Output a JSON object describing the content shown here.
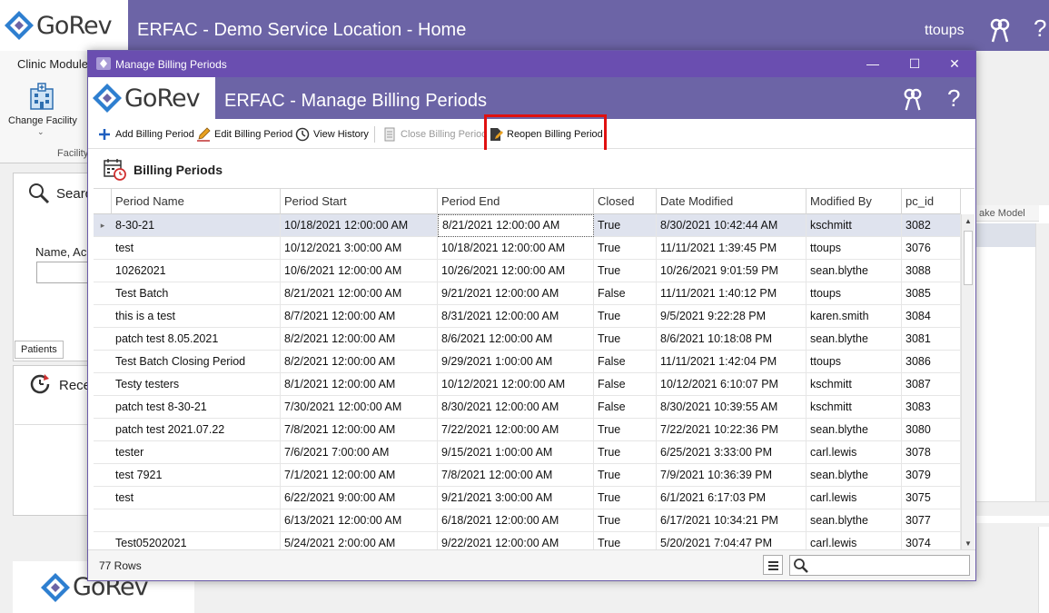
{
  "app": {
    "brand": "GoRev",
    "title": "ERFAC - Demo Service Location - Home",
    "user": "ttoups",
    "help": "?"
  },
  "background": {
    "ribbon_tab": "Clinic Module",
    "change_facility": "Change Facility",
    "facility_group": "Facility",
    "search_title": "Searc",
    "name_label": "Name, Ac",
    "patients_tab": "Patients",
    "recent_title": "Rece",
    "right_col_header": "ake Model"
  },
  "dialog": {
    "window_title": "Manage Billing Periods",
    "header_title": "ERFAC - Manage Billing Periods",
    "help": "?",
    "win_minimize": "—",
    "win_maximize": "☐",
    "win_close": "✕",
    "toolbar": {
      "add": "Add Billing Period",
      "edit": "Edit Billing Period",
      "history": "View History",
      "close": "Close Billing Period",
      "reopen": "Reopen Billing Period"
    },
    "section_title": "Billing Periods",
    "columns": [
      "Period Name",
      "Period Start",
      "Period End",
      "Closed",
      "Date Modified",
      "Modified By",
      "pc_id"
    ],
    "rows": [
      [
        "8-30-21",
        "10/18/2021 12:00:00 AM",
        "8/21/2021 12:00:00 AM",
        "True",
        "8/30/2021 10:42:44 AM",
        "kschmitt",
        "3082"
      ],
      [
        "test",
        "10/12/2021 3:00:00 AM",
        "10/18/2021 12:00:00 AM",
        "True",
        "11/11/2021 1:39:45 PM",
        "ttoups",
        "3076"
      ],
      [
        "10262021",
        "10/6/2021 12:00:00 AM",
        "10/26/2021 12:00:00 AM",
        "True",
        "10/26/2021 9:01:59 PM",
        "sean.blythe",
        "3088"
      ],
      [
        "Test Batch",
        "8/21/2021 12:00:00 AM",
        "9/21/2021 12:00:00 AM",
        "False",
        "11/11/2021 1:40:12 PM",
        "ttoups",
        "3085"
      ],
      [
        "this is a test",
        "8/7/2021 12:00:00 AM",
        "8/31/2021 12:00:00 AM",
        "True",
        "9/5/2021 9:22:28 PM",
        "karen.smith",
        "3084"
      ],
      [
        "patch test 8.05.2021",
        "8/2/2021 12:00:00 AM",
        "8/6/2021 12:00:00 AM",
        "True",
        "8/6/2021 10:18:08 PM",
        "sean.blythe",
        "3081"
      ],
      [
        "Test Batch Closing Period",
        "8/2/2021 12:00:00 AM",
        "9/29/2021 1:00:00 AM",
        "False",
        "11/11/2021 1:42:04 PM",
        "ttoups",
        "3086"
      ],
      [
        "Testy testers",
        "8/1/2021 12:00:00 AM",
        "10/12/2021 12:00:00 AM",
        "False",
        "10/12/2021 6:10:07 PM",
        "kschmitt",
        "3087"
      ],
      [
        "patch test 8-30-21",
        "7/30/2021 12:00:00 AM",
        "8/30/2021 12:00:00 AM",
        "False",
        "8/30/2021 10:39:55 AM",
        "kschmitt",
        "3083"
      ],
      [
        "patch test 2021.07.22",
        "7/8/2021 12:00:00 AM",
        "7/22/2021 12:00:00 AM",
        "True",
        "7/22/2021 10:22:36 PM",
        "sean.blythe",
        "3080"
      ],
      [
        "tester",
        "7/6/2021 7:00:00 AM",
        "9/15/2021 1:00:00 AM",
        "True",
        "6/25/2021 3:33:00 PM",
        "carl.lewis",
        "3078"
      ],
      [
        "test 7921",
        "7/1/2021 12:00:00 AM",
        "7/8/2021 12:00:00 AM",
        "True",
        "7/9/2021 10:36:39 PM",
        "sean.blythe",
        "3079"
      ],
      [
        "test",
        "6/22/2021 9:00:00 AM",
        "9/21/2021 3:00:00 AM",
        "True",
        "6/1/2021 6:17:03 PM",
        "carl.lewis",
        "3075"
      ],
      [
        "",
        "6/13/2021 12:00:00 AM",
        "6/18/2021 12:00:00 AM",
        "True",
        "6/17/2021 10:34:21 PM",
        "sean.blythe",
        "3077"
      ],
      [
        "Test05202021",
        "5/24/2021 2:00:00 AM",
        "9/22/2021 12:00:00 AM",
        "True",
        "5/20/2021 7:04:47 PM",
        "carl.lewis",
        "3074"
      ]
    ],
    "row_count": "77 Rows",
    "search_placeholder": ""
  },
  "colors": {
    "header_purple": "#6c64a6",
    "titlebar_purple": "#6a4eb0",
    "highlight_red": "#e01010",
    "selected_row": "#dfe3ee"
  },
  "icons": {
    "brand": "gorev-diamond-logo-icon",
    "keys": "keys-icon",
    "add": "plus-icon",
    "edit": "pencil-icon",
    "history": "clock-icon",
    "close": "document-lines-icon",
    "reopen": "document-pencil-icon",
    "section": "calendar-clock-icon",
    "search": "magnifier-icon",
    "menu": "hamburger-menu-icon"
  }
}
